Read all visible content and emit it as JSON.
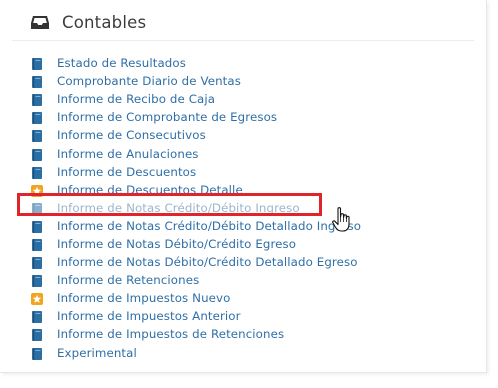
{
  "section": {
    "title": "Contables",
    "icon": "inbox-tray-icon"
  },
  "items": [
    {
      "label": "Estado de Resultados",
      "icon": "book-icon"
    },
    {
      "label": "Comprobante Diario de Ventas",
      "icon": "book-icon"
    },
    {
      "label": "Informe de Recibo de Caja",
      "icon": "book-icon"
    },
    {
      "label": "Informe de Comprobante de Egresos",
      "icon": "book-icon"
    },
    {
      "label": "Informe de Consecutivos",
      "icon": "book-icon"
    },
    {
      "label": "Informe de Anulaciones",
      "icon": "book-icon"
    },
    {
      "label": "Informe de Descuentos",
      "icon": "book-icon"
    },
    {
      "label": "Informe de Descuentos Detalle",
      "icon": "star-new-icon"
    },
    {
      "label": "Informe de Notas Crédito/Débito Ingreso",
      "icon": "book-icon",
      "state": "hovered"
    },
    {
      "label": "Informe de Notas Crédito/Débito Detallado Ingreso",
      "icon": "book-icon"
    },
    {
      "label": "Informe de Notas Débito/Crédito Egreso",
      "icon": "book-icon"
    },
    {
      "label": "Informe de Notas Débito/Crédito Detallado Egreso",
      "icon": "book-icon"
    },
    {
      "label": "Informe de Retenciones",
      "icon": "book-icon"
    },
    {
      "label": "Informe de Impuestos Nuevo",
      "icon": "star-new-icon"
    },
    {
      "label": "Informe de Impuestos Anterior",
      "icon": "book-icon"
    },
    {
      "label": "Informe de Impuestos de Retenciones",
      "icon": "book-icon"
    },
    {
      "label": "Experimental",
      "icon": "book-icon"
    }
  ],
  "colors": {
    "link": "#2f6fa6",
    "highlight_box": "#e0242b",
    "book_icon": "#2b6ea3",
    "star_icon": "#f2a41f"
  }
}
